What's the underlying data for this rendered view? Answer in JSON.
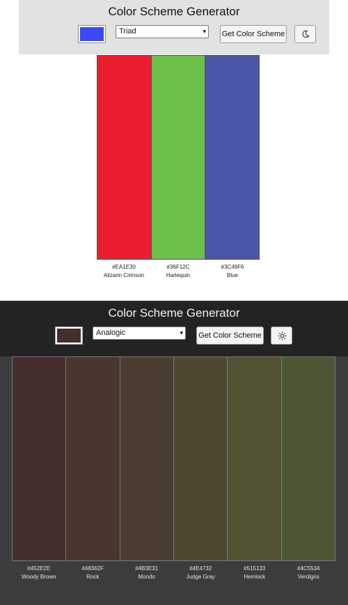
{
  "light": {
    "title": "Color Scheme Generator",
    "seed_color": "#3C49F6",
    "mode_selected": "Triad",
    "get_button": "Get Color Scheme",
    "theme_toggle_icon": "moon-icon",
    "colors": [
      {
        "hex": "#EA1E30",
        "name": "Alizarin Crimson",
        "swatch": "#EA1E30"
      },
      {
        "hex": "#36F12C",
        "name": "Harlequin",
        "swatch": "#6CC04A"
      },
      {
        "hex": "#3C49F6",
        "name": "Blue",
        "swatch": "#4B56A6"
      }
    ]
  },
  "dark": {
    "title": "Color Scheme Generator",
    "seed_color": "#452E2E",
    "mode_selected": "Analogic",
    "get_button": "Get Color Scheme",
    "theme_toggle_icon": "sun-icon",
    "colors": [
      {
        "hex": "#452E2E",
        "name": "Woody Brown",
        "swatch": "#452E2E"
      },
      {
        "hex": "#48362F",
        "name": "Rock",
        "swatch": "#48362F"
      },
      {
        "hex": "#4B3E31",
        "name": "Mondo",
        "swatch": "#4B3E31"
      },
      {
        "hex": "#4E4732",
        "name": "Judge Gray",
        "swatch": "#4E4732"
      },
      {
        "hex": "#515133",
        "name": "Hemlock",
        "swatch": "#515133"
      },
      {
        "hex": "#4C5534",
        "name": "Verdigris",
        "swatch": "#4C5534"
      }
    ]
  }
}
